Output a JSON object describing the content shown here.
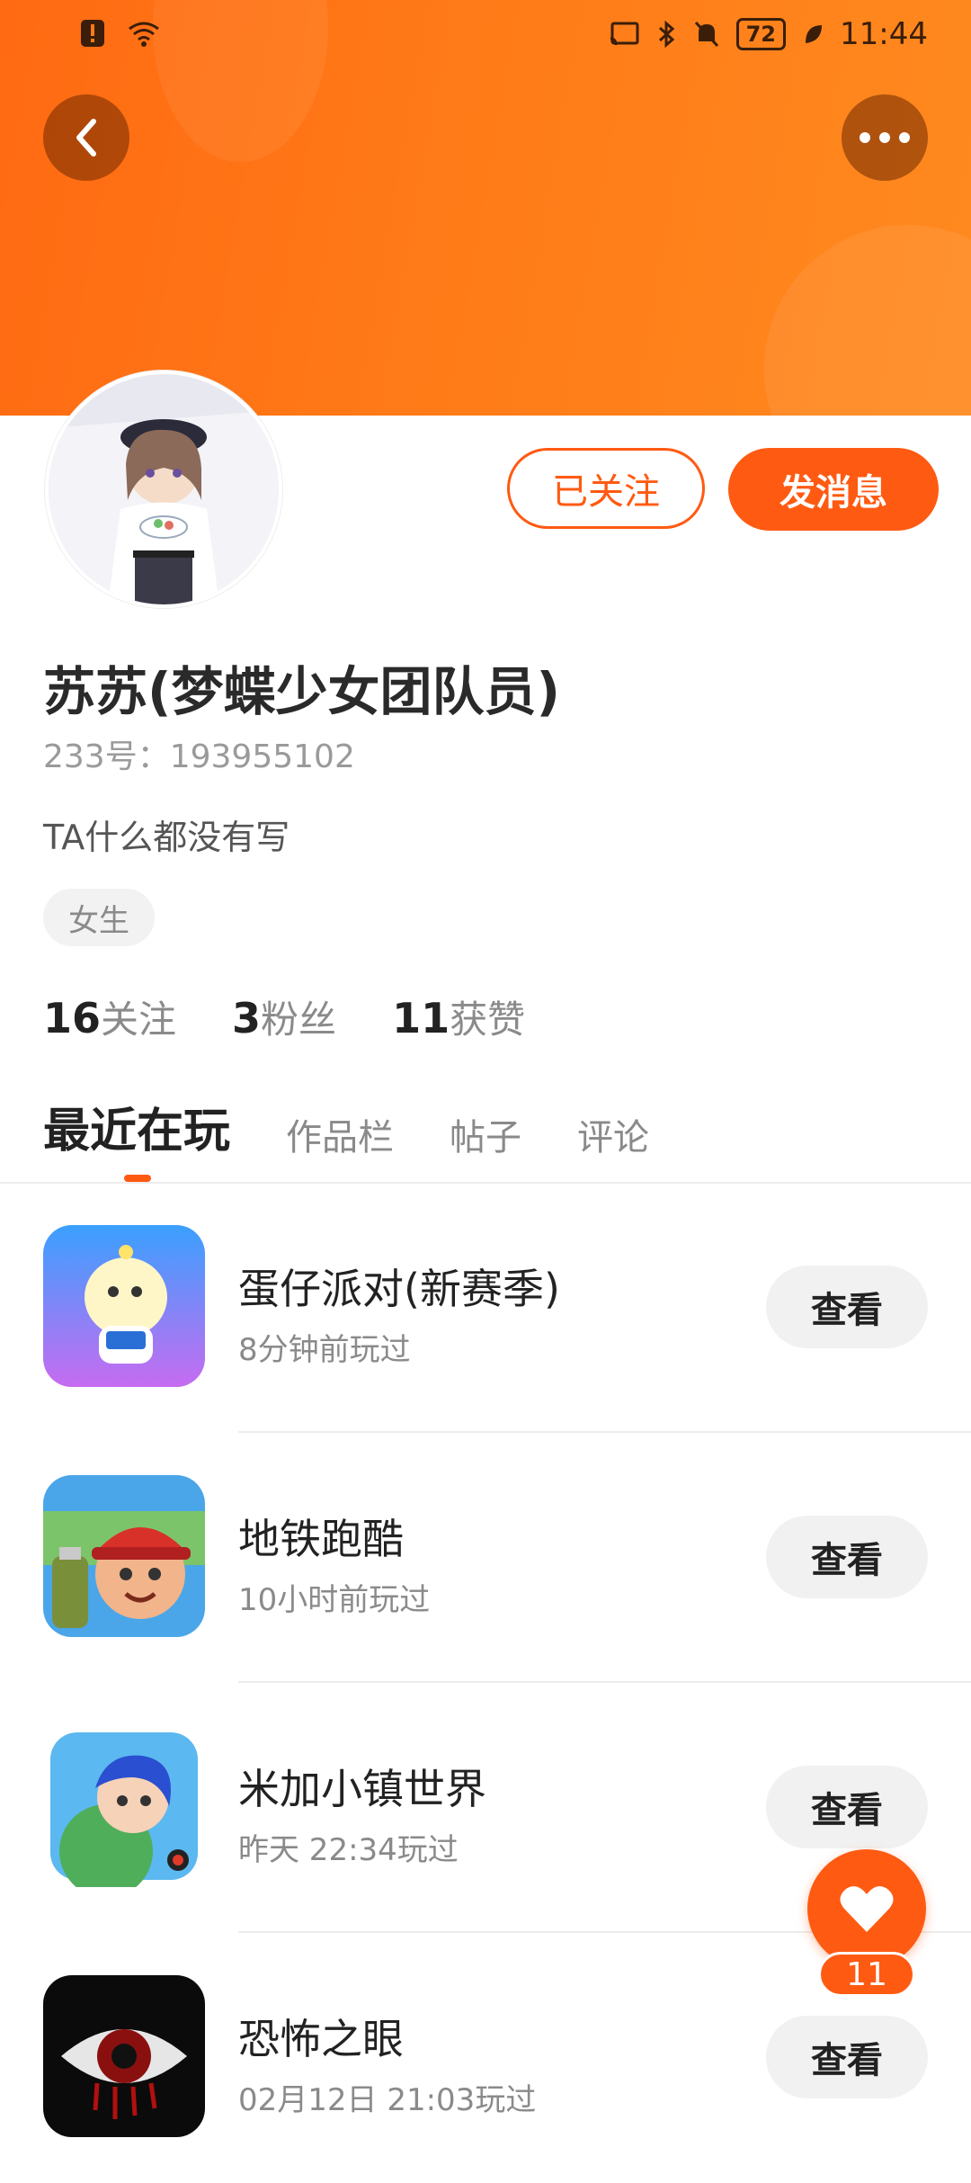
{
  "status_bar": {
    "time": "11:44",
    "battery": "72"
  },
  "profile": {
    "name": "苏苏(梦蝶少女团队员)",
    "uid": "233号：193955102",
    "bio": "TA什么都没有写",
    "gender_tag": "女生",
    "follow_button": "已关注",
    "message_button": "发消息"
  },
  "stats": [
    {
      "value": "16",
      "label": "关注"
    },
    {
      "value": "3",
      "label": "粉丝"
    },
    {
      "value": "11",
      "label": "获赞"
    }
  ],
  "tabs": [
    {
      "label": "最近在玩",
      "active": true
    },
    {
      "label": "作品栏",
      "active": false
    },
    {
      "label": "帖子",
      "active": false
    },
    {
      "label": "评论",
      "active": false
    }
  ],
  "games": [
    {
      "title": "蛋仔派对(新赛季)",
      "played": "8分钟前玩过",
      "button": "查看",
      "icon": "egg-party-icon"
    },
    {
      "title": "地铁跑酷",
      "played": "10小时前玩过",
      "button": "查看",
      "icon": "subway-surfers-icon"
    },
    {
      "title": "米加小镇世界",
      "played": "昨天 22:34玩过",
      "button": "查看",
      "icon": "miga-world-icon"
    },
    {
      "title": "恐怖之眼",
      "played": "02月12日 21:03玩过",
      "button": "查看",
      "icon": "eyes-horror-icon"
    }
  ],
  "like_fab": {
    "count": "11"
  },
  "colors": {
    "accent": "#ff5a12",
    "header_start": "#ff6a12",
    "header_end": "#ff8a1f"
  }
}
